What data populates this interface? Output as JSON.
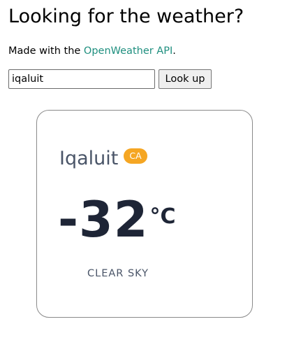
{
  "header": {
    "title": "Looking for the weather?",
    "subtitle_prefix": "Made with the ",
    "api_link": "OpenWeather API",
    "subtitle_suffix": "."
  },
  "search": {
    "value": "iqaluit",
    "button_label": "Look up"
  },
  "weather": {
    "city": "Iqaluit",
    "country": "CA",
    "temperature": "-32",
    "unit": "°C",
    "condition": "CLEAR SKY"
  },
  "colors": {
    "link": "#1f8f7f",
    "badge": "#f5a623",
    "city_text": "#4a5568",
    "temperature_text": "#1e2536"
  }
}
